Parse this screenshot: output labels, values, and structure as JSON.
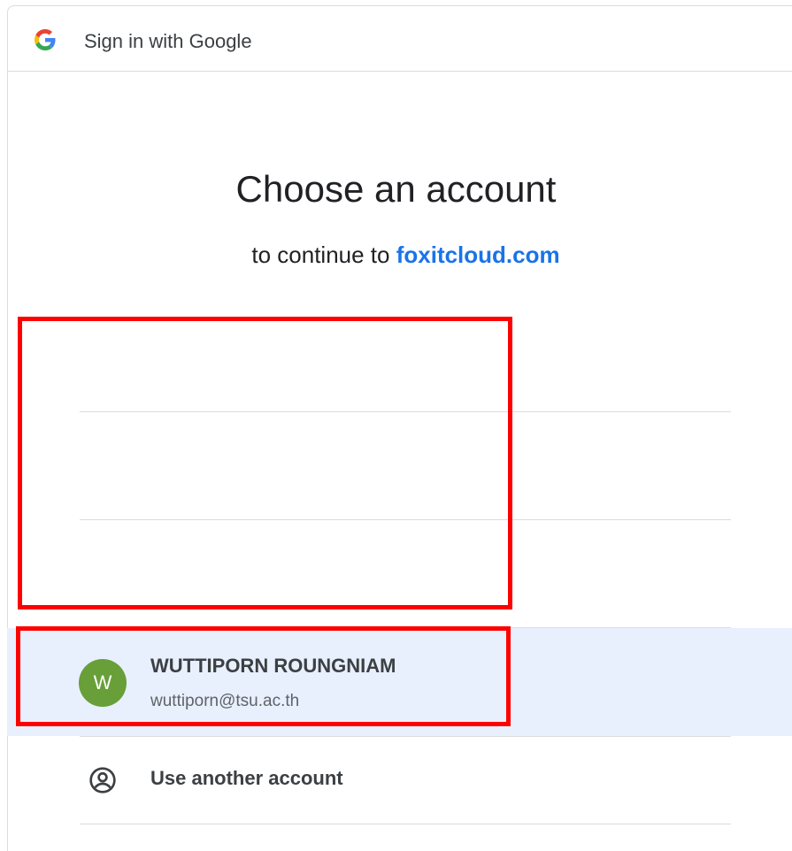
{
  "titlebar": {
    "logo_icon": "google-g-icon",
    "title": "Sign in with Google"
  },
  "main": {
    "heading": "Choose an account",
    "subheading_prefix": "to continue to ",
    "subheading_link": "foxitcloud.com"
  },
  "account": {
    "avatar_letter": "W",
    "avatar_color": "#689f38",
    "name": "WUTTIPORN ROUNGNIAM",
    "email": "wuttiporn@tsu.ac.th",
    "highlight_color": "#e8f0fe"
  },
  "other_account": {
    "icon": "account-circle-icon",
    "label": "Use another account"
  },
  "colors": {
    "link": "#1a73e8",
    "annotation": "#ff0000",
    "divider": "#dadce0"
  }
}
